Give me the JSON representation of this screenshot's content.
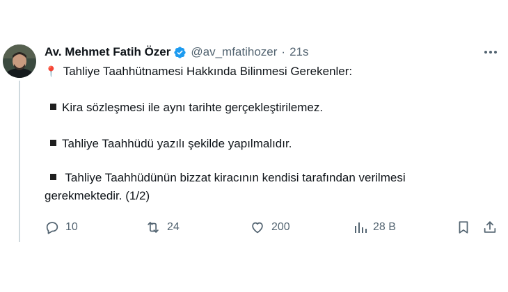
{
  "tweet": {
    "author_name": "Av. Mehmet Fatih Özer",
    "handle": "@av_mfatihozer",
    "separator": "·",
    "time": "21s",
    "pin_emoji": "📍",
    "lines": [
      "Tahliye Taahhütnamesi Hakkında Bilinmesi Gerekenler:",
      "Kira sözleşmesi ile aynı tarihte gerçekleştirilemez.",
      "Tahliye Taahhüdü yazılı şekilde yapılmalıdır.",
      " Tahliye Taahhüdünün bizzat kiracının kendisi tarafından verilmesi",
      "gerekmektedir. (1/2)"
    ],
    "verified_color": "#1d9bf0"
  },
  "actions": {
    "replies": "10",
    "reposts": "24",
    "likes": "200",
    "views": "28 B"
  },
  "icons": {
    "avatar": "avatar",
    "verified": "verified-badge-icon",
    "more": "more-icon",
    "reply": "reply-icon",
    "repost": "repost-icon",
    "like": "heart-icon",
    "views": "views-chart-icon",
    "bookmark": "bookmark-icon",
    "share": "share-icon"
  }
}
